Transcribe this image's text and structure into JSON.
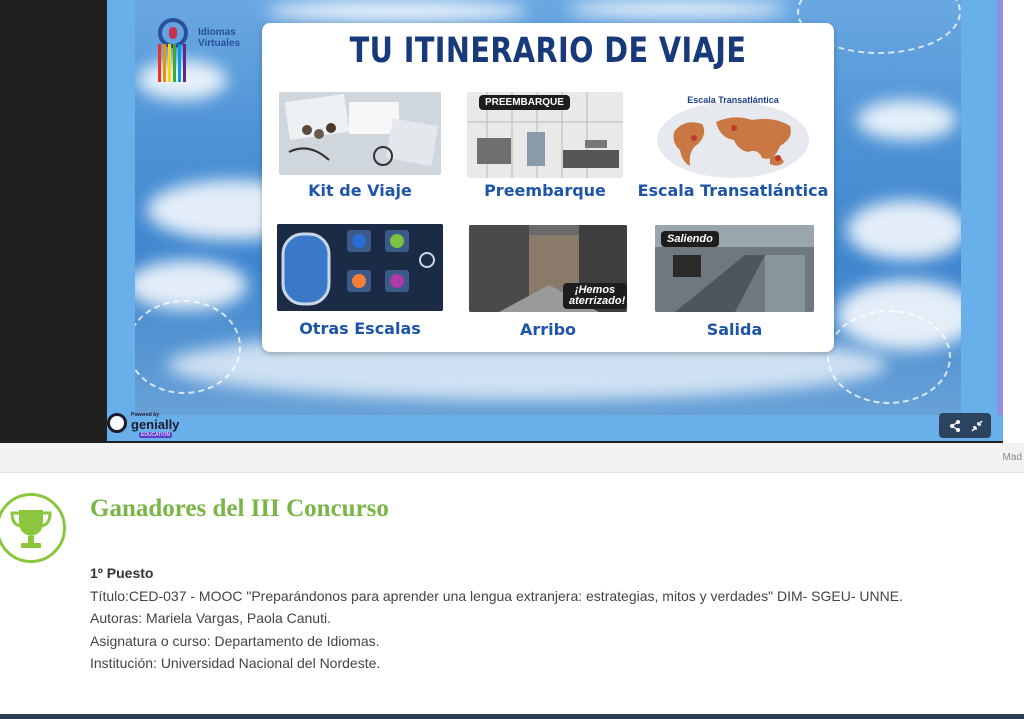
{
  "presentation": {
    "logo_text": [
      "Idiomas",
      "Virtuales"
    ],
    "title": "TU ITINERARIO DE VIAJE",
    "tiles": [
      {
        "label": "Kit de Viaje",
        "overlay": ""
      },
      {
        "label": "Preembarque",
        "overlay": "PREEMBARQUE"
      },
      {
        "label": "Escala Transatlántica",
        "overlay": "Escala Transatlántica"
      },
      {
        "label": "Otras Escalas",
        "overlay": ""
      },
      {
        "label": "Arribo",
        "overlay": "¡Hemos aterrizado!"
      },
      {
        "label": "Salida",
        "overlay": "Saliendo"
      }
    ],
    "genially": {
      "powered": "Powered by",
      "brand": "genially",
      "edition": "EDUCATION"
    },
    "controls": {
      "share_icon": "share-icon",
      "collapse_icon": "collapse-icon"
    }
  },
  "top_bar": {
    "right_text": "Mad"
  },
  "award": {
    "icon": "trophy-icon",
    "accent_color": "#8cc63f",
    "heading": "Ganadores del III Concurso",
    "place": "1º Puesto",
    "lines": [
      "Título:CED-037 - MOOC \"Preparándonos para aprender una lengua extranjera: estrategias, mitos y verdades\" DIM- SGEU- UNNE.",
      "Autoras: Mariela Vargas, Paola Canuti.",
      "Asignatura o curso: Departamento de Idiomas.",
      "Institución: Universidad Nacional del Nordeste."
    ]
  }
}
